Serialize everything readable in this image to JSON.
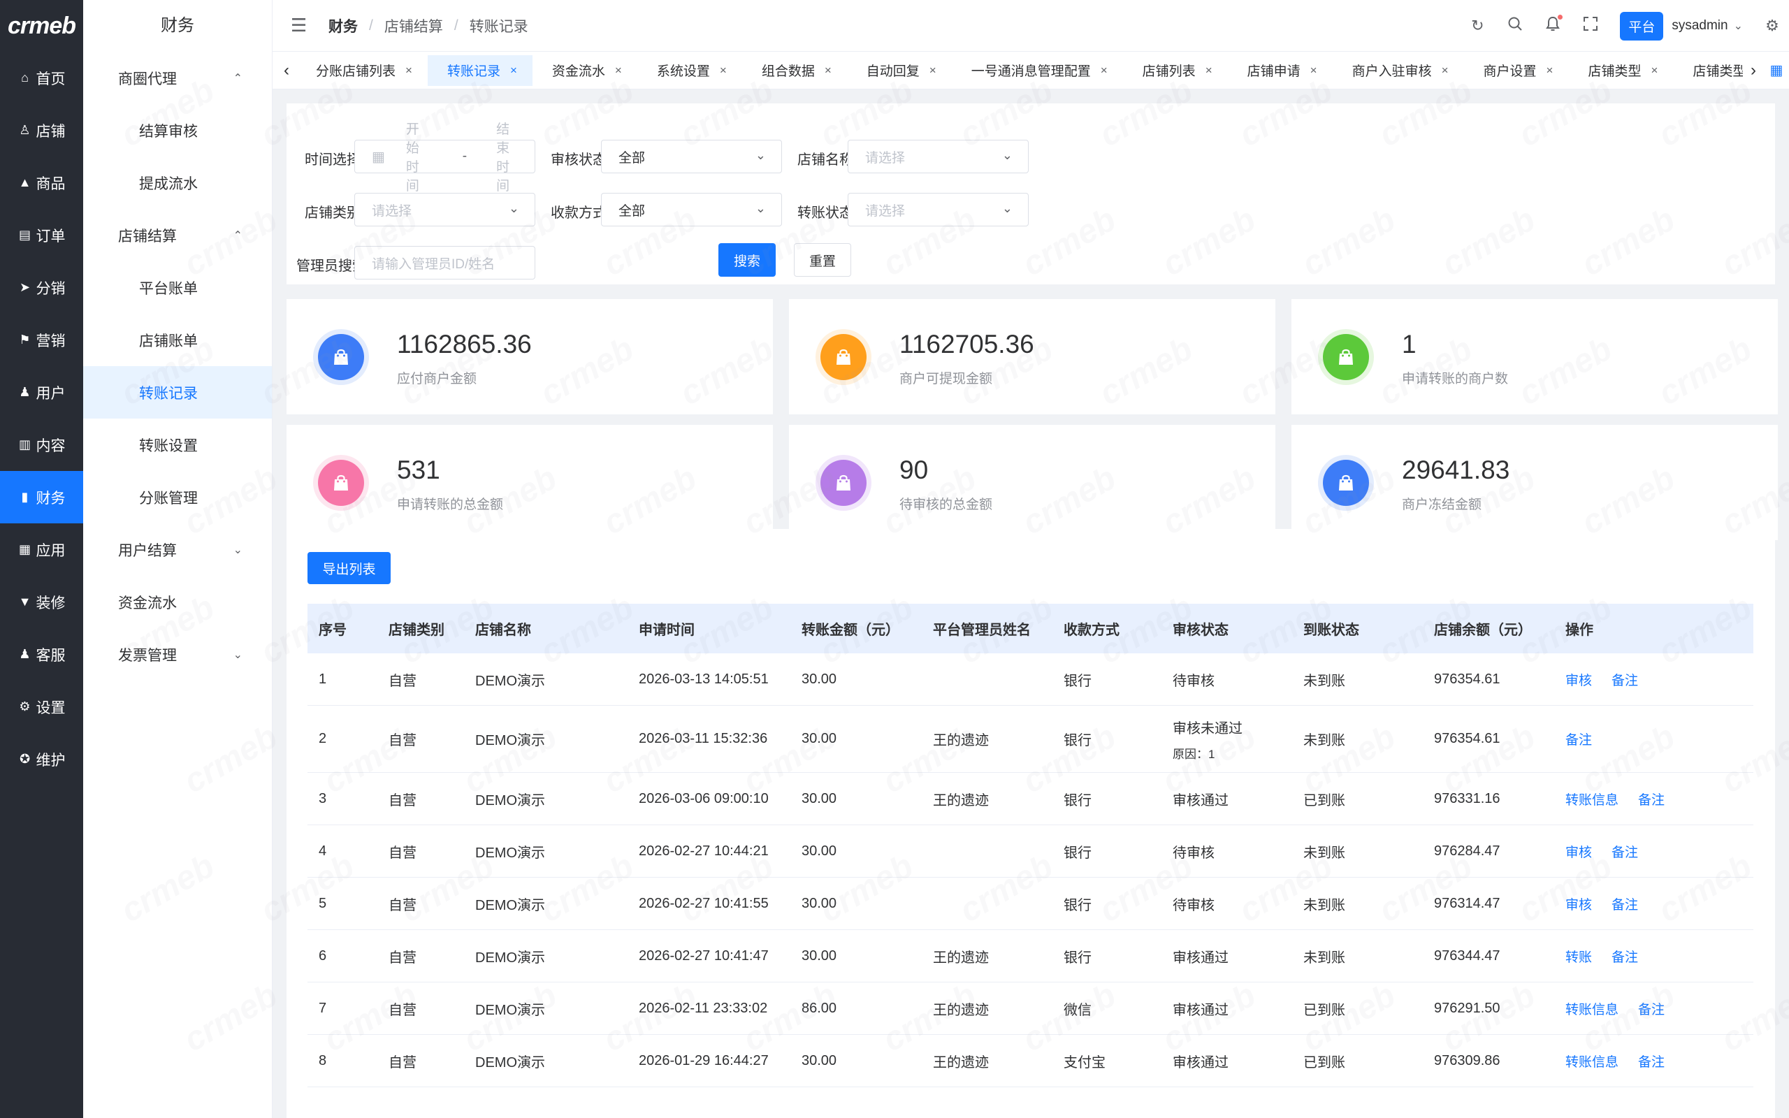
{
  "logo": "crmeb",
  "rail": [
    {
      "icon": "home-icon",
      "glyph": "⌂",
      "label": "首页"
    },
    {
      "icon": "store-icon",
      "glyph": "♙",
      "label": "店铺"
    },
    {
      "icon": "goods-icon",
      "glyph": "▲",
      "label": "商品"
    },
    {
      "icon": "order-icon",
      "glyph": "▤",
      "label": "订单"
    },
    {
      "icon": "distribution-icon",
      "glyph": "➤",
      "label": "分销"
    },
    {
      "icon": "marketing-icon",
      "glyph": "⚑",
      "label": "营销"
    },
    {
      "icon": "user-icon",
      "glyph": "♟",
      "label": "用户"
    },
    {
      "icon": "content-icon",
      "glyph": "▥",
      "label": "内容"
    },
    {
      "icon": "finance-icon",
      "glyph": "▮",
      "label": "财务"
    },
    {
      "icon": "app-icon",
      "glyph": "▦",
      "label": "应用"
    },
    {
      "icon": "decorate-icon",
      "glyph": "▼",
      "label": "装修"
    },
    {
      "icon": "service-icon",
      "glyph": "♟",
      "label": "客服"
    },
    {
      "icon": "settings-icon",
      "glyph": "⚙",
      "label": "设置"
    },
    {
      "icon": "maintain-icon",
      "glyph": "✪",
      "label": "维护"
    }
  ],
  "submenu": {
    "title": "财务",
    "items": [
      {
        "label": "商圈代理",
        "level": 1,
        "arrow": "⌃"
      },
      {
        "label": "结算审核",
        "level": 2
      },
      {
        "label": "提成流水",
        "level": 2
      },
      {
        "label": "店铺结算",
        "level": 1,
        "arrow": "⌃"
      },
      {
        "label": "平台账单",
        "level": 2
      },
      {
        "label": "店铺账单",
        "level": 2
      },
      {
        "label": "转账记录",
        "level": 2,
        "active": true
      },
      {
        "label": "转账设置",
        "level": 2
      },
      {
        "label": "分账管理",
        "level": 2
      },
      {
        "label": "用户结算",
        "level": 1,
        "arrow": "⌄"
      },
      {
        "label": "资金流水",
        "level": 1
      },
      {
        "label": "发票管理",
        "level": 1,
        "arrow": "⌄"
      }
    ]
  },
  "header": {
    "breadcrumb": [
      "财务",
      "店铺结算",
      "转账记录"
    ],
    "platform": "平台",
    "user": "sysadmin"
  },
  "tabs": [
    {
      "label": "分账店铺列表"
    },
    {
      "label": "转账记录",
      "active": true
    },
    {
      "label": "资金流水"
    },
    {
      "label": "系统设置"
    },
    {
      "label": "组合数据"
    },
    {
      "label": "自动回复"
    },
    {
      "label": "一号通消息管理配置"
    },
    {
      "label": "店铺列表"
    },
    {
      "label": "店铺申请"
    },
    {
      "label": "商户入驻审核"
    },
    {
      "label": "商户设置"
    },
    {
      "label": "店铺类型"
    },
    {
      "label": "店铺类型"
    }
  ],
  "filters": {
    "time_label": "时间选择:",
    "start_placeholder": "开始时间",
    "date_sep": "-",
    "end_placeholder": "结束时间",
    "audit_label": "审核状态:",
    "audit_value": "全部",
    "store_name_label": "店铺名称:",
    "store_name_placeholder": "请选择",
    "store_type_label": "店铺类别:",
    "store_type_placeholder": "请选择",
    "payment_label": "收款方式:",
    "payment_value": "全部",
    "transfer_label": "转账状态:",
    "transfer_placeholder": "请选择",
    "admin_label": "管理员搜索:",
    "admin_placeholder": "请输入管理员ID/姓名",
    "search_button": "搜索",
    "reset_button": "重置"
  },
  "cards": [
    {
      "value": "1162865.36",
      "label": "应付商户金额",
      "color": "#3d7cf7",
      "ring": "#e3ecfd"
    },
    {
      "value": "1162705.36",
      "label": "商户可提现金额",
      "color": "#ff9f1c",
      "ring": "#fff1de"
    },
    {
      "value": "1",
      "label": "申请转账的商户数",
      "color": "#5cc93a",
      "ring": "#e6f7df"
    },
    {
      "value": "531",
      "label": "申请转账的总金额",
      "color": "#f776a8",
      "ring": "#fde6ef"
    },
    {
      "value": "90",
      "label": "待审核的总金额",
      "color": "#b67ce8",
      "ring": "#f1e6fb"
    },
    {
      "value": "29641.83",
      "label": "商户冻结金额",
      "color": "#3d7cf7",
      "ring": "#e3ecfd"
    }
  ],
  "table": {
    "export_button": "导出列表",
    "columns": [
      "序号",
      "店铺类别",
      "店铺名称",
      "申请时间",
      "转账金额（元）",
      "平台管理员姓名",
      "收款方式",
      "审核状态",
      "到账状态",
      "店铺余额（元）",
      "操作"
    ],
    "rows": [
      {
        "id": "1",
        "type": "自营",
        "name": "DEMO演示",
        "time": "2026-03-13 14:05:51",
        "amount": "30.00",
        "admin": "",
        "method": "银行",
        "audit": "待审核",
        "reason": "",
        "arrive": "未到账",
        "balance": "976354.61",
        "actions": [
          "审核",
          "备注"
        ]
      },
      {
        "id": "2",
        "type": "自营",
        "name": "DEMO演示",
        "time": "2026-03-11 15:32:36",
        "amount": "30.00",
        "admin": "王的遗迹",
        "method": "银行",
        "audit": "审核未通过",
        "reason": "原因：1",
        "arrive": "未到账",
        "balance": "976354.61",
        "actions": [
          "备注"
        ]
      },
      {
        "id": "3",
        "type": "自营",
        "name": "DEMO演示",
        "time": "2026-03-06 09:00:10",
        "amount": "30.00",
        "admin": "王的遗迹",
        "method": "银行",
        "audit": "审核通过",
        "reason": "",
        "arrive": "已到账",
        "balance": "976331.16",
        "actions": [
          "转账信息",
          "备注"
        ]
      },
      {
        "id": "4",
        "type": "自营",
        "name": "DEMO演示",
        "time": "2026-02-27 10:44:21",
        "amount": "30.00",
        "admin": "",
        "method": "银行",
        "audit": "待审核",
        "reason": "",
        "arrive": "未到账",
        "balance": "976284.47",
        "actions": [
          "审核",
          "备注"
        ]
      },
      {
        "id": "5",
        "type": "自营",
        "name": "DEMO演示",
        "time": "2026-02-27 10:41:55",
        "amount": "30.00",
        "admin": "",
        "method": "银行",
        "audit": "待审核",
        "reason": "",
        "arrive": "未到账",
        "balance": "976314.47",
        "actions": [
          "审核",
          "备注"
        ]
      },
      {
        "id": "6",
        "type": "自营",
        "name": "DEMO演示",
        "time": "2026-02-27 10:41:47",
        "amount": "30.00",
        "admin": "王的遗迹",
        "method": "银行",
        "audit": "审核通过",
        "reason": "",
        "arrive": "未到账",
        "balance": "976344.47",
        "actions": [
          "转账",
          "备注"
        ]
      },
      {
        "id": "7",
        "type": "自营",
        "name": "DEMO演示",
        "time": "2026-02-11 23:33:02",
        "amount": "86.00",
        "admin": "王的遗迹",
        "method": "微信",
        "audit": "审核通过",
        "reason": "",
        "arrive": "已到账",
        "balance": "976291.50",
        "actions": [
          "转账信息",
          "备注"
        ]
      },
      {
        "id": "8",
        "type": "自营",
        "name": "DEMO演示",
        "time": "2026-01-29 16:44:27",
        "amount": "30.00",
        "admin": "王的遗迹",
        "method": "支付宝",
        "audit": "审核通过",
        "reason": "",
        "arrive": "已到账",
        "balance": "976309.86",
        "actions": [
          "转账信息",
          "备注"
        ]
      }
    ]
  }
}
